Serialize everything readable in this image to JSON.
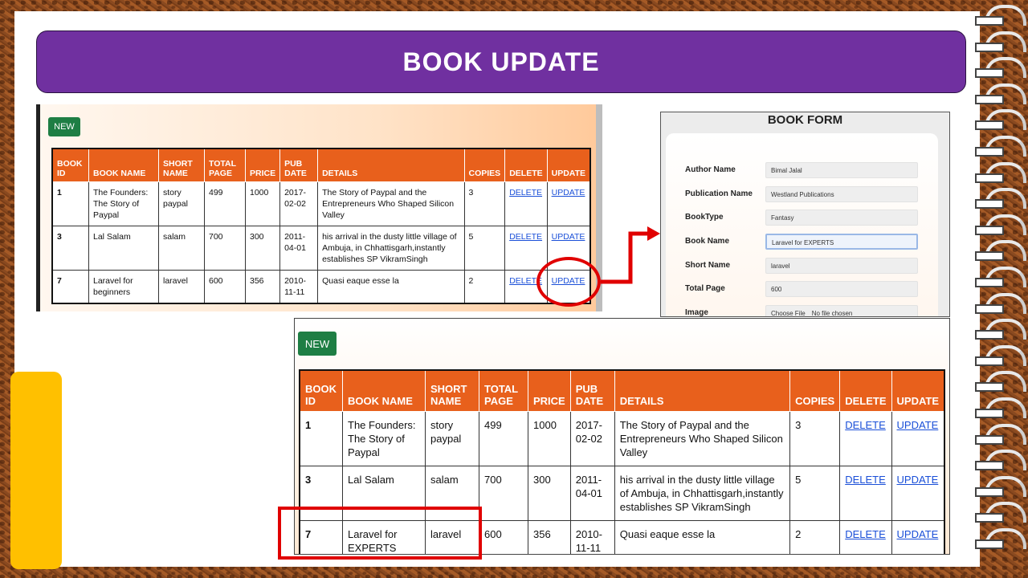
{
  "slide": {
    "title": "BOOK UPDATE"
  },
  "colors": {
    "title_bg": "#7030a0",
    "table_header": "#e8601c",
    "new_button": "#1e7e44",
    "annotation": "#e00000",
    "accent_block": "#ffc000"
  },
  "list_before": {
    "new_label": "NEW",
    "headers": [
      "BOOK ID",
      "BOOK NAME",
      "SHORT NAME",
      "TOTAL PAGE",
      "PRICE",
      "PUB DATE",
      "DETAILS",
      "COPIES",
      "DELETE",
      "UPDATE"
    ],
    "rows": [
      {
        "id": "1",
        "book_name": "The Founders: The Story of Paypal",
        "short_name": "story paypal",
        "total_page": "499",
        "price": "1000",
        "pub_date": "2017-02-02",
        "details": "The Story of Paypal and the Entrepreneurs Who Shaped Silicon Valley",
        "copies": "3",
        "delete": "DELETE",
        "update": "UPDATE"
      },
      {
        "id": "3",
        "book_name": "Lal Salam",
        "short_name": "salam",
        "total_page": "700",
        "price": "300",
        "pub_date": "2011-04-01",
        "details": "his arrival in the dusty little village of Ambuja, in Chhattisgarh,instantly establishes SP VikramSingh",
        "copies": "5",
        "delete": "DELETE",
        "update": "UPDATE"
      },
      {
        "id": "7",
        "book_name": "Laravel for beginners",
        "short_name": "laravel",
        "total_page": "600",
        "price": "356",
        "pub_date": "2010-11-11",
        "details": "Quasi eaque esse la",
        "copies": "2",
        "delete": "DELETE",
        "update": "UPDATE"
      }
    ]
  },
  "book_form": {
    "title": "BOOK FORM",
    "fields": [
      {
        "label": "Author Name",
        "value": "Bimal Jalal"
      },
      {
        "label": "Publication Name",
        "value": "Westland Publications"
      },
      {
        "label": "BookType",
        "value": "Fantasy"
      },
      {
        "label": "Book Name",
        "value": "Laravel for EXPERTS"
      },
      {
        "label": "Short Name",
        "value": "laravel"
      },
      {
        "label": "Total Page",
        "value": "600"
      },
      {
        "label": "Image",
        "button": "Choose File",
        "value": "No file chosen"
      }
    ]
  },
  "list_after": {
    "new_label": "NEW",
    "headers": [
      "BOOK ID",
      "BOOK NAME",
      "SHORT NAME",
      "TOTAL PAGE",
      "PRICE",
      "PUB DATE",
      "DETAILS",
      "COPIES",
      "DELETE",
      "UPDATE"
    ],
    "rows": [
      {
        "id": "1",
        "book_name": "The Founders: The Story of Paypal",
        "short_name": "story paypal",
        "total_page": "499",
        "price": "1000",
        "pub_date": "2017-02-02",
        "details": "The Story of Paypal and the Entrepreneurs Who Shaped Silicon Valley",
        "copies": "3",
        "delete": "DELETE",
        "update": "UPDATE"
      },
      {
        "id": "3",
        "book_name": "Lal Salam",
        "short_name": "salam",
        "total_page": "700",
        "price": "300",
        "pub_date": "2011-04-01",
        "details": "his arrival in the dusty little village of Ambuja, in Chhattisgarh,instantly establishes SP VikramSingh",
        "copies": "5",
        "delete": "DELETE",
        "update": "UPDATE"
      },
      {
        "id": "7",
        "book_name": "Laravel for EXPERTS",
        "short_name": "laravel",
        "total_page": "600",
        "price": "356",
        "pub_date": "2010-11-11",
        "details": "Quasi eaque esse la",
        "copies": "2",
        "delete": "DELETE",
        "update": "UPDATE"
      }
    ]
  }
}
